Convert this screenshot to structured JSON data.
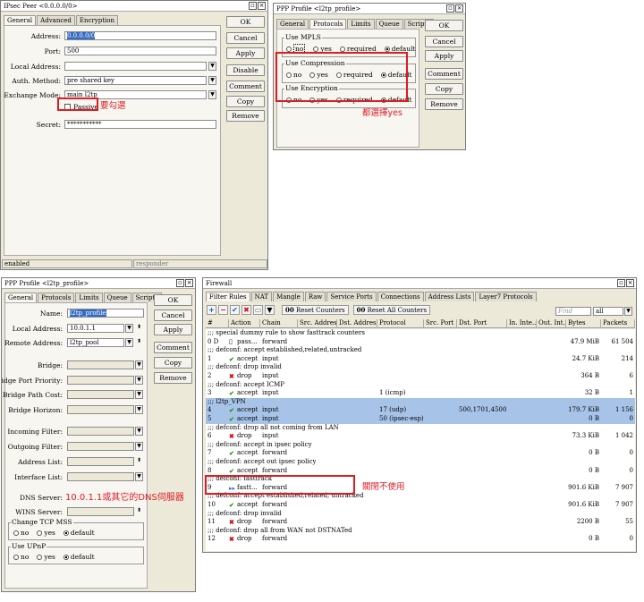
{
  "ipsec": {
    "title": "IPsec Peer <0.0.0.0/0>",
    "tabs": [
      "General",
      "Advanced",
      "Encryption"
    ],
    "fields": [
      {
        "label": "Address:",
        "value": "0.0.0.0/0"
      },
      {
        "label": "Port:",
        "value": "500"
      },
      {
        "label": "Local Address:",
        "value": ""
      },
      {
        "label": "Auth. Method:",
        "value": "pre shared key"
      },
      {
        "label": "Exchange Mode:",
        "value": "main l2tp"
      }
    ],
    "passive_label": "Passive",
    "passive_note": "要勾選",
    "secret_label": "Secret:",
    "secret_value": "***********",
    "buttons": [
      "OK",
      "Cancel",
      "Apply",
      "Disable",
      "Comment",
      "Copy",
      "Remove"
    ],
    "status_left": "enabled",
    "status_right": "responder"
  },
  "ppp_top": {
    "title": "PPP Profile <l2tp_profile>",
    "tabs": [
      "General",
      "Protocols",
      "Limits",
      "Queue",
      "Scripts"
    ],
    "groups": [
      {
        "title": "Use MPLS",
        "selected": "default"
      },
      {
        "title": "Use Compression",
        "selected": "default"
      },
      {
        "title": "Use Encryption",
        "selected": "default"
      }
    ],
    "options": [
      "no",
      "yes",
      "required",
      "default"
    ],
    "note": "都選擇yes",
    "buttons": [
      "OK",
      "Cancel",
      "Apply",
      "Comment",
      "Copy",
      "Remove"
    ]
  },
  "ppp_bottom": {
    "title": "PPP Profile <l2tp_profile>",
    "tabs": [
      "General",
      "Protocols",
      "Limits",
      "Queue",
      "Scripts"
    ],
    "fields": [
      {
        "label": "Name:",
        "value": "l2tp_profile"
      },
      {
        "label": "Local Address:",
        "value": "10.0.1.1"
      },
      {
        "label": "Remote Address:",
        "value": "l2tp_pool"
      },
      {
        "label": "Bridge:",
        "value": ""
      },
      {
        "label": "Bridge Port Priority:",
        "value": ""
      },
      {
        "label": "Bridge Path Cost:",
        "value": ""
      },
      {
        "label": "Bridge Horizon:",
        "value": ""
      },
      {
        "label": "Incoming Filter:",
        "value": ""
      },
      {
        "label": "Outgoing Filter:",
        "value": ""
      },
      {
        "label": "Address List:",
        "value": ""
      },
      {
        "label": "Interface List:",
        "value": ""
      },
      {
        "label": "DNS Server:",
        "value": ""
      },
      {
        "label": "WINS Server:",
        "value": ""
      }
    ],
    "dns_note": "10.0.1.1或其它的DNS伺服器",
    "groups": [
      {
        "title": "Change TCP MSS",
        "selected": "default"
      },
      {
        "title": "Use UPnP",
        "selected": "default"
      }
    ],
    "options": [
      "no",
      "yes",
      "default"
    ],
    "buttons": [
      "OK",
      "Cancel",
      "Apply",
      "Comment",
      "Copy",
      "Remove"
    ]
  },
  "firewall": {
    "title": "Firewall",
    "tabs": [
      "Filter Rules",
      "NAT",
      "Mangle",
      "Raw",
      "Service Ports",
      "Connections",
      "Address Lists",
      "Layer7 Protocols"
    ],
    "toolbar": {
      "reset": "Reset Counters",
      "reset_all": "Reset All Counters",
      "find_placeholder": "Find",
      "chain_filter": "all"
    },
    "columns": [
      "#",
      "Action",
      "Chain",
      "Src. Address",
      "Dst. Address",
      "Protocol",
      "Src. Port",
      "Dst. Port",
      "In. Inte...",
      "Out. Int...",
      "Bytes",
      "Packets"
    ],
    "rows": [
      {
        "kind": "comment",
        "text": ";;; special dummy rule to show fasttrack counters"
      },
      {
        "kind": "rule",
        "num": "0 D",
        "action": "pass...",
        "icon": "pass",
        "chain": "forward",
        "protocol": "",
        "dst_port": "",
        "bytes": "47.9 MiB",
        "packets": "61 504"
      },
      {
        "kind": "comment",
        "text": ";;; defconf: accept established,related,untracked"
      },
      {
        "kind": "rule",
        "num": "1",
        "action": "accept",
        "icon": "accept",
        "chain": "input",
        "protocol": "",
        "dst_port": "",
        "bytes": "24.7 KiB",
        "packets": "214"
      },
      {
        "kind": "comment",
        "text": ";;; defconf: drop invalid"
      },
      {
        "kind": "rule",
        "num": "2",
        "action": "drop",
        "icon": "drop",
        "chain": "input",
        "protocol": "",
        "dst_port": "",
        "bytes": "364 B",
        "packets": "6"
      },
      {
        "kind": "comment",
        "text": ";;; defconf: accept ICMP"
      },
      {
        "kind": "rule",
        "num": "3",
        "action": "accept",
        "icon": "accept",
        "chain": "input",
        "protocol": "1 (icmp)",
        "dst_port": "",
        "bytes": "32 B",
        "packets": "1"
      },
      {
        "kind": "comment",
        "text": ";;; l2tp_VPN",
        "highlight": true
      },
      {
        "kind": "rule",
        "num": "4",
        "action": "accept",
        "icon": "accept",
        "chain": "input",
        "protocol": "17 (udp)",
        "dst_port": "500,1701,4500",
        "bytes": "179.7 KiB",
        "packets": "1 156",
        "highlight": true
      },
      {
        "kind": "rule",
        "num": "5",
        "action": "accept",
        "icon": "accept",
        "chain": "input",
        "protocol": "50 (ipsec-esp)",
        "dst_port": "",
        "bytes": "0 B",
        "packets": "0",
        "highlight": true
      },
      {
        "kind": "comment",
        "text": ";;; defconf: drop all not coming from LAN"
      },
      {
        "kind": "rule",
        "num": "6",
        "action": "drop",
        "icon": "drop",
        "chain": "input",
        "protocol": "",
        "dst_port": "",
        "bytes": "73.3 KiB",
        "packets": "1 042"
      },
      {
        "kind": "comment",
        "text": ";;; defconf: accept in ipsec policy"
      },
      {
        "kind": "rule",
        "num": "7",
        "action": "accept",
        "icon": "accept",
        "chain": "forward",
        "protocol": "",
        "dst_port": "",
        "bytes": "0 B",
        "packets": "0"
      },
      {
        "kind": "comment",
        "text": ";;; defconf: accept out ipsec policy"
      },
      {
        "kind": "rule",
        "num": "8",
        "action": "accept",
        "icon": "accept",
        "chain": "forward",
        "protocol": "",
        "dst_port": "",
        "bytes": "0 B",
        "packets": "0"
      },
      {
        "kind": "comment",
        "text": ";;; defconf: fasttrack"
      },
      {
        "kind": "rule",
        "num": "9",
        "action": "fastt...",
        "icon": "fasttrack",
        "chain": "forward",
        "protocol": "",
        "dst_port": "",
        "bytes": "901.6 KiB",
        "packets": "7 907"
      },
      {
        "kind": "comment",
        "text": ";;; defconf: accept established,related, untracked"
      },
      {
        "kind": "rule",
        "num": "10",
        "action": "accept",
        "icon": "accept",
        "chain": "forward",
        "protocol": "",
        "dst_port": "",
        "bytes": "901.6 KiB",
        "packets": "7 907"
      },
      {
        "kind": "comment",
        "text": ";;; defconf: drop invalid"
      },
      {
        "kind": "rule",
        "num": "11",
        "action": "drop",
        "icon": "drop",
        "chain": "forward",
        "protocol": "",
        "dst_port": "",
        "bytes": "2200 B",
        "packets": "55"
      },
      {
        "kind": "comment",
        "text": ";;; defconf: drop all from WAN not DSTNATed"
      },
      {
        "kind": "rule",
        "num": "12",
        "action": "drop",
        "icon": "drop",
        "chain": "forward",
        "protocol": "",
        "dst_port": "",
        "bytes": "0 B",
        "packets": "0"
      }
    ],
    "fasttrack_note": "關閉不使用"
  }
}
